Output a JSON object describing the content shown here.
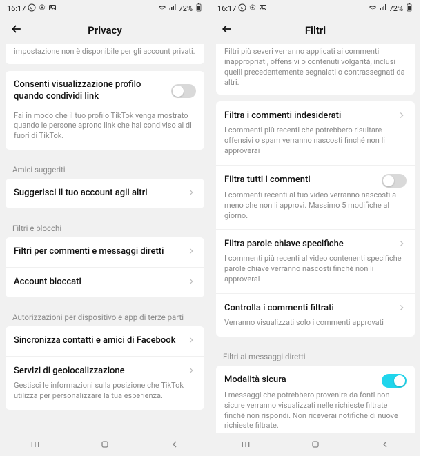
{
  "statusbar": {
    "time": "16:17",
    "battery": "72%"
  },
  "left": {
    "title": "Privacy",
    "intro_cut": "impostazione non è disponibile per gli account privati.",
    "profile_view": {
      "title": "Consenti visualizzazione profilo quando condividi link",
      "desc": "Fai in modo che il tuo profilo TikTok venga mostrato quando le persone aprono link che hai condiviso al di fuori di TikTok."
    },
    "section_friends": "Amici suggeriti",
    "suggest_account": "Suggerisci il tuo account agli altri",
    "section_filters": "Filtri e blocchi",
    "comment_filters": "Filtri per commenti e messaggi diretti",
    "blocked": "Account bloccati",
    "section_auth": "Autorizzazioni per dispositivo e app di terze parti",
    "sync": "Sincronizza contatti e amici di Facebook",
    "geo": "Servizi di geolocalizzazione",
    "geo_desc": "Gestisci le informazioni sulla posizione che TikTok utilizza per personalizzare la tua esperienza."
  },
  "right": {
    "title": "Filtri",
    "intro_cut": "Filtri più severi verranno applicati ai commenti inappropriati, offensivi o contenuti volgarità, inclusi quelli precedentemente segnalati o contrassegnati da altri.",
    "unwanted": {
      "title": "Filtra i commenti indesiderati",
      "desc": "I commenti più recenti che potrebbero risultare offensivi o spam verranno nascosti finché non li approverai"
    },
    "all": {
      "title": "Filtra tutti i commenti",
      "desc": "I commenti recenti al tuo video verranno nascosti a meno che non li approvi. Massimo 5 modifiche al giorno."
    },
    "keywords": {
      "title": "Filtra parole chiave specifiche",
      "desc": "I commenti più recenti al video contenenti specifiche parole chiave verranno nascosti finché non li approverai"
    },
    "review": {
      "title": "Controlla i commenti filtrati",
      "desc": "Verranno visualizzati solo i commenti approvati"
    },
    "section_dm": "Filtri ai messaggi diretti",
    "safe_mode": {
      "title": "Modalità sicura",
      "desc": "I messaggi che potrebbero provenire da fonti non sicure verranno visualizzati nelle richieste filtrate finché non rispondi. Non riceverai notifiche di nuove richieste filtrate."
    }
  }
}
